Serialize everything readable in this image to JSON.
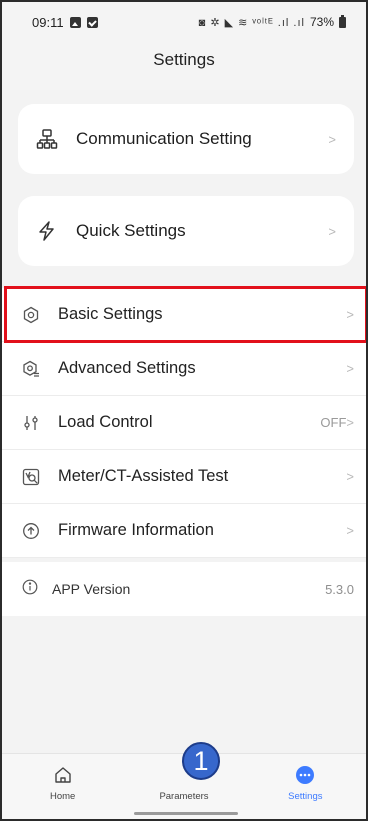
{
  "status_bar": {
    "time": "09:11",
    "right_glyphs": "◙ ✲ ◣ ≋ ᵛᵒˡᵗᴱ .ıl .ıl",
    "battery_text": "73%"
  },
  "header": {
    "title": "Settings"
  },
  "cards": {
    "communication": {
      "label": "Communication Setting",
      "icon": "network-icon"
    },
    "quick": {
      "label": "Quick Settings",
      "icon": "lightning-icon"
    }
  },
  "settings_list": [
    {
      "label": "Basic Settings",
      "value": "",
      "icon": "gear-icon",
      "highlighted": true
    },
    {
      "label": "Advanced Settings",
      "value": "",
      "icon": "advanced-gear-icon"
    },
    {
      "label": "Load Control",
      "value": "OFF",
      "icon": "sliders-icon"
    },
    {
      "label": "Meter/CT-Assisted Test",
      "value": "",
      "icon": "meter-test-icon"
    },
    {
      "label": "Firmware Information",
      "value": "",
      "icon": "upload-circle-icon"
    }
  ],
  "chevron": ">",
  "app_version": {
    "label": "APP Version",
    "value": "5.3.0",
    "icon": "info-icon"
  },
  "tabbar": {
    "tabs": [
      {
        "label": "Home",
        "icon": "home-icon",
        "active": false
      },
      {
        "label": "Parameters",
        "icon": "parameters-icon",
        "active": false
      },
      {
        "label": "Settings",
        "icon": "settings-dots-icon",
        "active": true
      }
    ]
  },
  "callout": {
    "number": "1"
  },
  "colors": {
    "accent": "#3d7bff",
    "highlight_border": "#e2101b",
    "callout_fill": "#3767cc"
  }
}
